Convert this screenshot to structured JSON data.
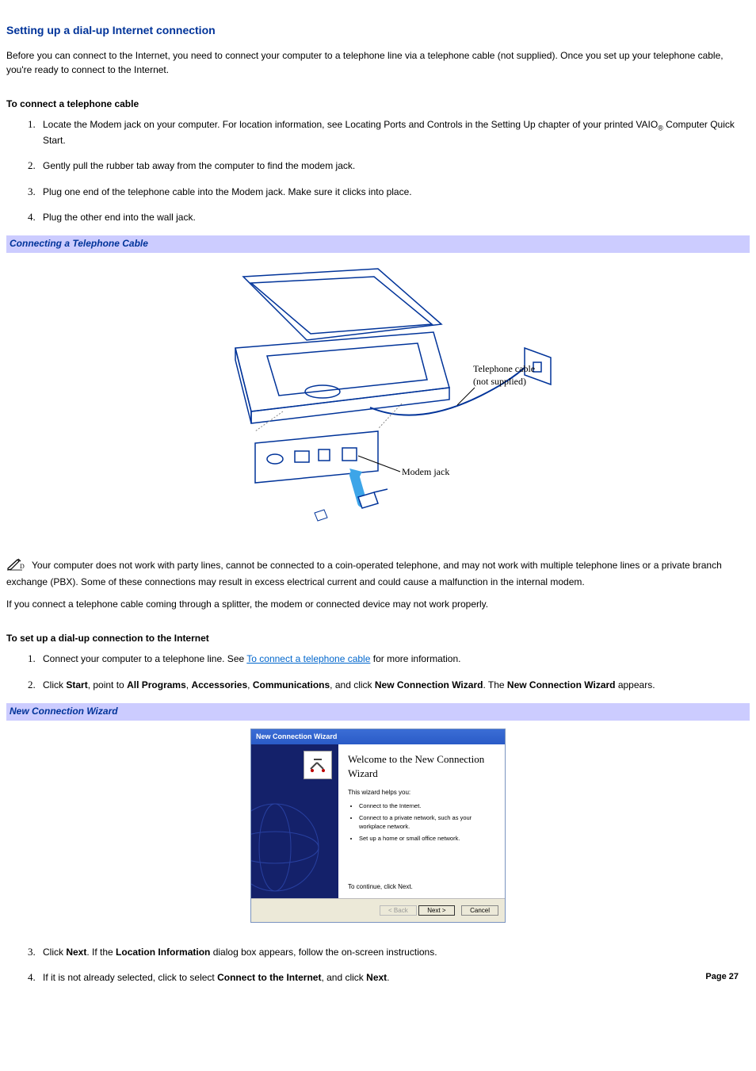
{
  "title": "Setting up a dial-up Internet connection",
  "intro": "Before you can connect to the Internet, you need to connect your computer to a telephone line via a telephone cable (not supplied). Once you set up your telephone cable, you're ready to connect to the Internet.",
  "section1_heading": "To connect a telephone cable",
  "list1": {
    "item1a": "Locate the Modem jack on your computer. For location information, see Locating Ports and Controls in the Setting Up chapter of your printed VAIO",
    "item1b": " Computer Quick Start.",
    "reg": "®",
    "item2": "Gently pull the rubber tab away from the computer to find the modem jack.",
    "item3": "Plug one end of the telephone cable into the Modem jack. Make sure it clicks into place.",
    "item4": "Plug the other end into the wall jack."
  },
  "caption1": "Connecting a Telephone Cable",
  "fig1": {
    "cable_label1": "Telephone cable",
    "cable_label2": "(not supplied)",
    "jack_label": "Modem jack"
  },
  "note1": "Your computer does not work with party lines, cannot be connected to a coin-operated telephone, and may not work with multiple telephone lines or a private branch exchange (PBX). Some of these connections may result in excess electrical current and could cause a malfunction in the internal modem.",
  "note2": "If you connect a telephone cable coming through a splitter, the modem or connected device may not work properly.",
  "section2_heading": "To set up a dial-up connection to the Internet",
  "list2": {
    "item1a": "Connect your computer to a telephone line. See ",
    "item1_link": "To connect a telephone cable",
    "item1b": " for more information.",
    "item2_a": "Click ",
    "item2_start": "Start",
    "item2_b": ", point to ",
    "item2_all": "All Programs",
    "item2_c": ", ",
    "item2_acc": "Accessories",
    "item2_d": ", ",
    "item2_comm": "Communications",
    "item2_e": ", and click ",
    "item2_ncw": "New Connection Wizard",
    "item2_f": ". The ",
    "item2_ncw2": "New Connection Wizard",
    "item2_g": " appears.",
    "item3_a": "Click ",
    "item3_next": "Next",
    "item3_b": ". If the ",
    "item3_loc": "Location Information",
    "item3_c": " dialog box appears, follow the on-screen instructions.",
    "item4_a": "If it is not already selected, click to select ",
    "item4_conn": "Connect to the Internet",
    "item4_b": ", and click ",
    "item4_next": "Next",
    "item4_c": "."
  },
  "caption2": "New Connection Wizard",
  "wizard": {
    "titlebar": "New Connection Wizard",
    "heading": "Welcome to the New Connection Wizard",
    "sub": "This wizard helps you:",
    "b1": "Connect to the Internet.",
    "b2": "Connect to a private network, such as your workplace network.",
    "b3": "Set up a home or small office network.",
    "cont": "To continue, click Next.",
    "back": "< Back",
    "next": "Next >",
    "cancel": "Cancel"
  },
  "page_num": "Page 27"
}
